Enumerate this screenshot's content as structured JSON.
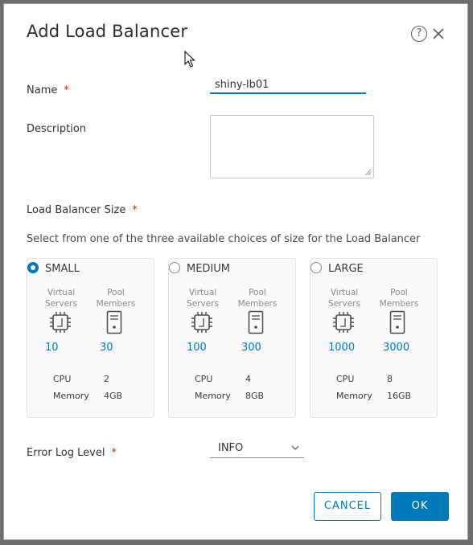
{
  "dialog": {
    "title": "Add Load Balancer",
    "help_symbol": "?"
  },
  "form": {
    "name_label": "Name",
    "name_value": "shiny-lb01",
    "required_mark": "*",
    "description_label": "Description",
    "description_value": "",
    "size_label": "Load Balancer Size",
    "size_hint": "Select from one of the three available choices of size for the Load Balancer",
    "error_log_label": "Error Log Level",
    "error_log_value": "INFO"
  },
  "sizes": [
    {
      "name": "SMALL",
      "selected": true,
      "virtual_servers_label": "Virtual Servers",
      "pool_members_label": "Pool Members",
      "virtual_servers": "10",
      "pool_members": "30",
      "cpu_label": "CPU",
      "cpu": "2",
      "memory_label": "Memory",
      "memory": "4GB"
    },
    {
      "name": "MEDIUM",
      "selected": false,
      "virtual_servers_label": "Virtual Servers",
      "pool_members_label": "Pool Members",
      "virtual_servers": "100",
      "pool_members": "300",
      "cpu_label": "CPU",
      "cpu": "4",
      "memory_label": "Memory",
      "memory": "8GB"
    },
    {
      "name": "LARGE",
      "selected": false,
      "virtual_servers_label": "Virtual Servers",
      "pool_members_label": "Pool Members",
      "virtual_servers": "1000",
      "pool_members": "3000",
      "cpu_label": "CPU",
      "cpu": "8",
      "memory_label": "Memory",
      "memory": "16GB"
    }
  ],
  "buttons": {
    "cancel": "CANCEL",
    "ok": "OK"
  },
  "colors": {
    "accent": "#0079b8",
    "required": "#c92100",
    "card_bg": "#fafafa"
  },
  "icons": [
    "help-icon",
    "close-icon",
    "mouse-cursor-icon",
    "cpu-chip-icon",
    "server-icon",
    "chevron-down-icon"
  ]
}
